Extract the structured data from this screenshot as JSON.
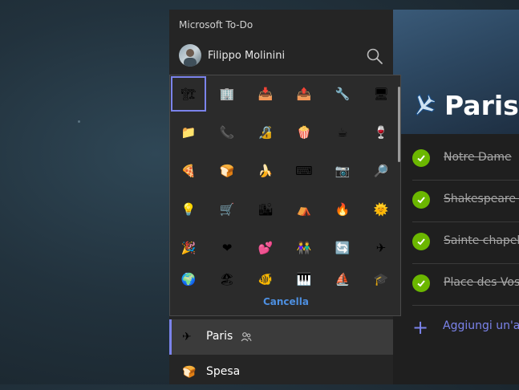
{
  "app": {
    "title": "Microsoft To-Do"
  },
  "user": {
    "name": "Filippo Molinini"
  },
  "icons": {
    "search": "search-icon",
    "shared": "people-icon",
    "list_icon": "airplane-icon"
  },
  "colors": {
    "accent": "#7b83eb",
    "complete": "#6bb700",
    "cancel": "#4d8fe0"
  },
  "picker": {
    "cancel_label": "Cancella",
    "icons": [
      {
        "name": "construction-icon",
        "glyph": "🏗"
      },
      {
        "name": "building-icon",
        "glyph": "🏢"
      },
      {
        "name": "inbox-tray-icon",
        "glyph": "📥"
      },
      {
        "name": "outbox-tray-icon",
        "glyph": "📤"
      },
      {
        "name": "wrench-icon",
        "glyph": "🔧"
      },
      {
        "name": "monitor-icon",
        "glyph": "🖥"
      },
      {
        "name": "folder-icon",
        "glyph": "📁"
      },
      {
        "name": "telephone-icon",
        "glyph": "📞"
      },
      {
        "name": "lock-icon",
        "glyph": "🔏"
      },
      {
        "name": "popcorn-icon",
        "glyph": "🍿"
      },
      {
        "name": "coffee-mug-icon",
        "glyph": "☕"
      },
      {
        "name": "wine-glass-icon",
        "glyph": "🍷"
      },
      {
        "name": "pizza-icon",
        "glyph": "🍕"
      },
      {
        "name": "bread-icon",
        "glyph": "🍞"
      },
      {
        "name": "banana-icon",
        "glyph": "🍌"
      },
      {
        "name": "keyboard-icon",
        "glyph": "⌨"
      },
      {
        "name": "camera-icon",
        "glyph": "📷"
      },
      {
        "name": "magnifier-icon",
        "glyph": "🔎"
      },
      {
        "name": "lightbulb-icon",
        "glyph": "💡"
      },
      {
        "name": "shopping-cart-icon",
        "glyph": "🛒"
      },
      {
        "name": "cityscape-icon",
        "glyph": "🏙"
      },
      {
        "name": "tent-icon",
        "glyph": "⛺"
      },
      {
        "name": "fire-icon",
        "glyph": "🔥"
      },
      {
        "name": "sun-icon",
        "glyph": "🌞"
      },
      {
        "name": "party-popper-icon",
        "glyph": "🎉"
      },
      {
        "name": "heart-icon",
        "glyph": "❤"
      },
      {
        "name": "two-hearts-icon",
        "glyph": "💕"
      },
      {
        "name": "people-icon",
        "glyph": "👫"
      },
      {
        "name": "repeat-icon",
        "glyph": "🔄"
      },
      {
        "name": "airplane-icon",
        "glyph": "✈"
      },
      {
        "name": "globe-icon",
        "glyph": "🌍"
      },
      {
        "name": "beach-icon",
        "glyph": "🏖"
      },
      {
        "name": "fish-icon",
        "glyph": "🐠"
      },
      {
        "name": "piano-icon",
        "glyph": "🎹"
      },
      {
        "name": "ship-icon",
        "glyph": "⛵"
      },
      {
        "name": "hat-icon",
        "glyph": "🎓"
      }
    ]
  },
  "sidebar": {
    "lists": [
      {
        "label": "Paris",
        "icon": "airplane-icon",
        "glyph": "✈",
        "active": true,
        "shared": true
      },
      {
        "label": "Spesa",
        "icon": "bread-icon",
        "glyph": "🍞",
        "active": false,
        "shared": false
      }
    ]
  },
  "main": {
    "list_title": "Paris",
    "tasks": [
      {
        "text": "Notre Dame",
        "completed": true
      },
      {
        "text": "Shakespeare a",
        "completed": true
      },
      {
        "text": "Sainte chapelle",
        "completed": true
      },
      {
        "text": "Place des Vosg",
        "completed": true
      }
    ],
    "add_task_label": "Aggiungi un'at"
  }
}
